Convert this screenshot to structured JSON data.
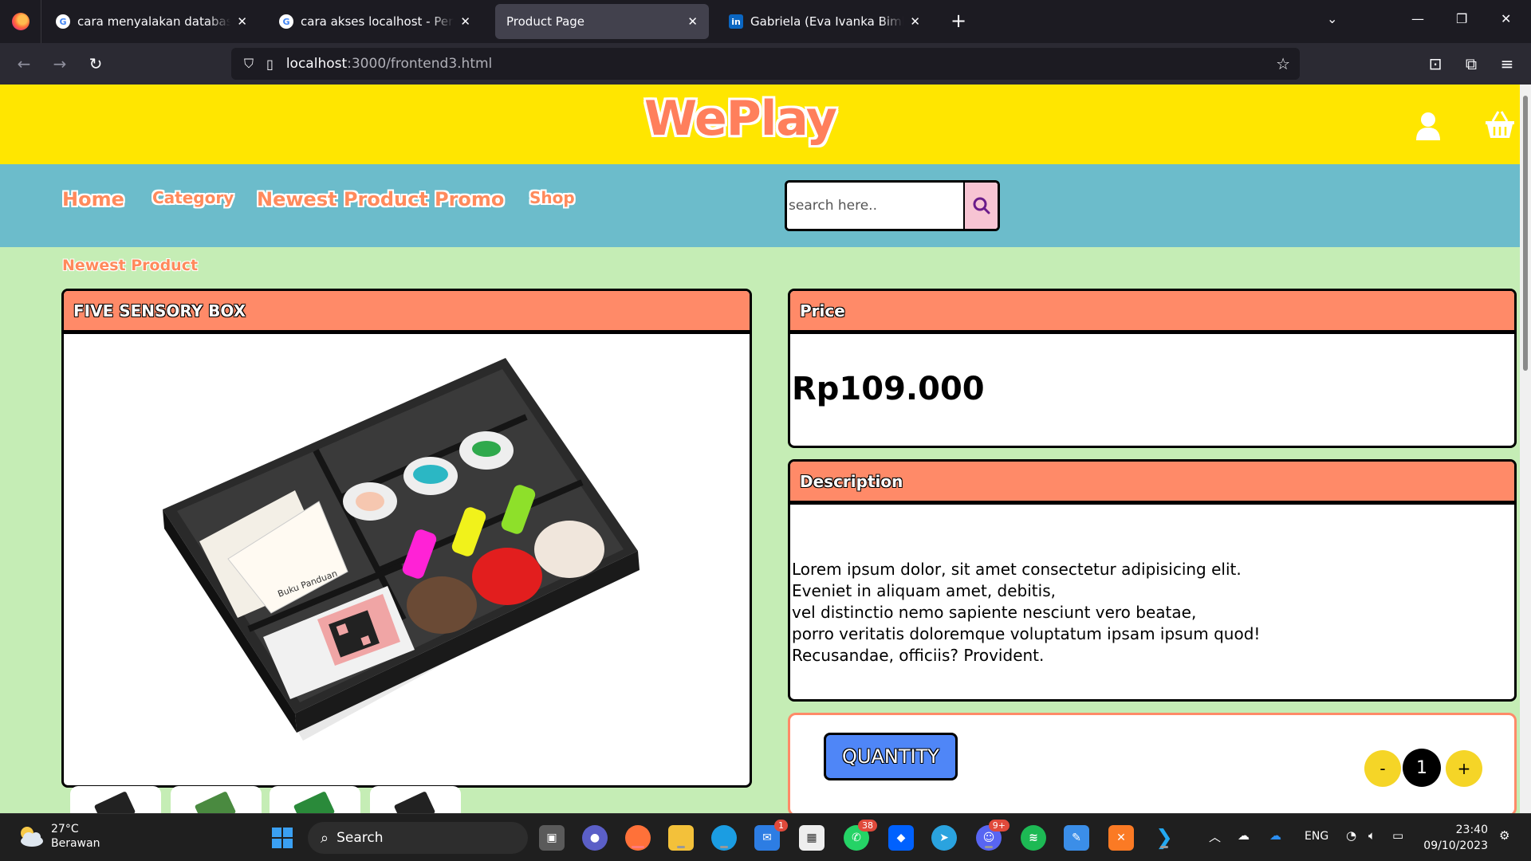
{
  "browser": {
    "tabs": [
      {
        "title": "cara menyalakan database - Penelusuran Google",
        "icon": "google-icon"
      },
      {
        "title": "cara akses localhost - Penelusuran Google",
        "icon": "google-icon"
      },
      {
        "title": "Product Page",
        "icon": "none",
        "active": true
      },
      {
        "title": "Gabriela (Eva Ivanka Bimbin) Bimbin",
        "icon": "linkedin-icon"
      }
    ],
    "url_host": "localhost",
    "url_path": ":3000/frontend3.html"
  },
  "site": {
    "logo": "WePlay",
    "nav": [
      "Home",
      "Category",
      "Newest Product",
      "Promo",
      "Shop"
    ],
    "search_placeholder": "search here.."
  },
  "product": {
    "breadcrumb": "Newest Product",
    "name": "FIVE SENSORY BOX",
    "price_header": "Price",
    "price": "Rp109.000",
    "description_header": "Description",
    "description_lines": [
      "Lorem ipsum dolor, sit amet consectetur adipisicing elit.",
      "Eveniet in aliquam amet, debitis,",
      "vel distinctio nemo sapiente nesciunt vero beatae,",
      "porro veritatis doloremque voluptatum ipsam ipsum quod!",
      "Recusandae, officiis? Provident."
    ],
    "quantity_label": "QUANTITY",
    "quantity_minus": "-",
    "quantity_value": "1",
    "quantity_plus": "+"
  },
  "taskbar": {
    "weather_temp": "27°C",
    "weather_desc": "Berawan",
    "search_label": "Search",
    "badges": {
      "mail": "1",
      "whatsapp": "38",
      "discord": "9+"
    },
    "lang": "ENG",
    "time": "23:40",
    "date": "09/10/2023"
  },
  "colors": {
    "header_yellow": "#ffe600",
    "menu_teal": "#6cbccb",
    "page_green": "#c5edb5",
    "accent_salmon": "#ff8a68",
    "quantity_blue": "#4f86f7"
  }
}
